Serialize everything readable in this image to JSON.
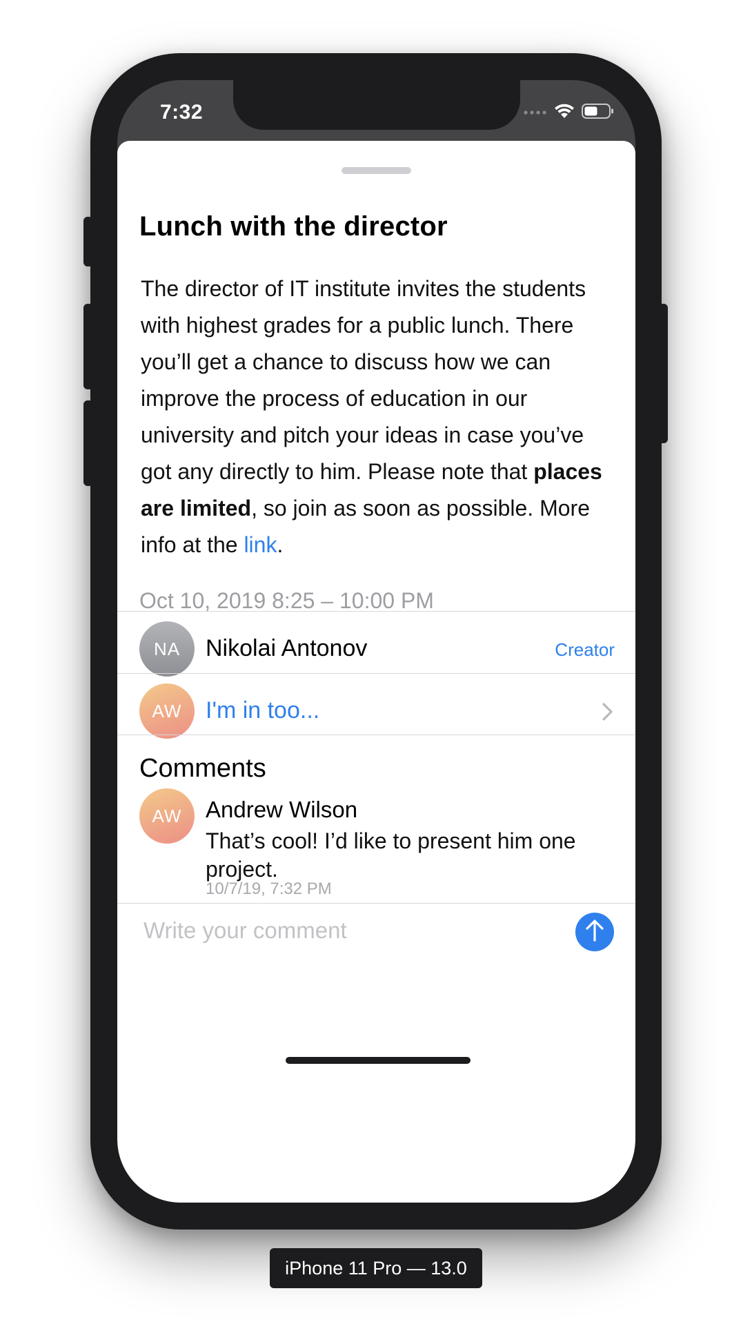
{
  "status_bar": {
    "time": "7:32",
    "icons": [
      "signal-icon",
      "wifi-icon",
      "battery-icon"
    ]
  },
  "event": {
    "title": "Lunch with the director",
    "description": {
      "part1": "The director of IT institute invites the students with highest grades for a public lunch. There you’ll get a chance to discuss how we can improve the process of education in our university and pitch your ideas in case you’ve got any directly to him. Please note that ",
      "bold": "places are limited",
      "part2": ", so join as soon as possible. More info at the ",
      "link": "link",
      "part3": "."
    },
    "datetime": "Oct 10, 2019 8:25 – 10:00 PM"
  },
  "creator_row": {
    "initials": "NA",
    "name": "Nikolai Antonov",
    "role": "Creator"
  },
  "join_row": {
    "initials": "AW",
    "label": "I'm in too..."
  },
  "comments": {
    "title": "Comments",
    "items": [
      {
        "initials": "AW",
        "author": "Andrew Wilson",
        "text": "That’s cool! I’d like to present him one project.",
        "date": "10/7/19, 7:32 PM"
      }
    ]
  },
  "composer": {
    "placeholder": "Write your comment"
  },
  "device_label": "iPhone 11 Pro — 13.0",
  "colors": {
    "accent": "#2f80ed",
    "secondary_text": "#9d9da2",
    "device_frame": "#1c1c1e"
  }
}
